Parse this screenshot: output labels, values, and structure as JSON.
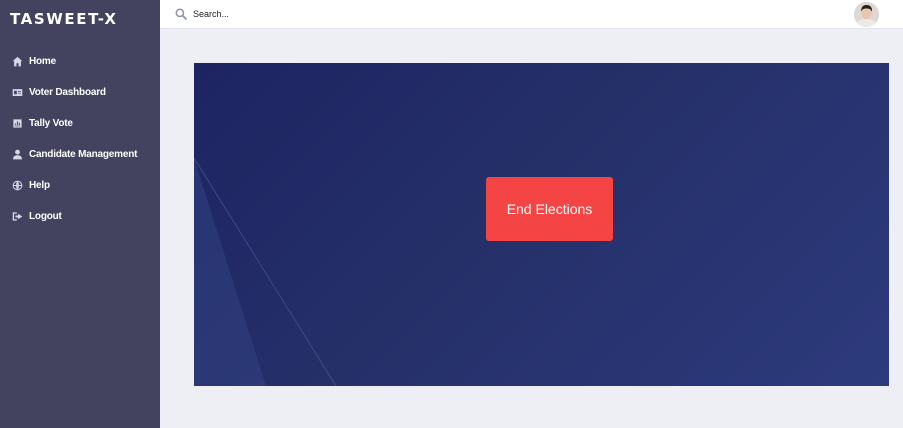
{
  "app": {
    "brand": "TASWEET-X"
  },
  "sidebar": {
    "items": [
      {
        "label": "Home",
        "icon": "home-icon"
      },
      {
        "label": "Voter Dashboard",
        "icon": "id-card-icon"
      },
      {
        "label": "Tally Vote",
        "icon": "chart-icon"
      },
      {
        "label": "Candidate Management",
        "icon": "user-icon"
      },
      {
        "label": "Help",
        "icon": "globe-icon"
      },
      {
        "label": "Logout",
        "icon": "sign-out-icon"
      }
    ]
  },
  "topbar": {
    "search": {
      "placeholder": "Search..."
    },
    "avatar_icon": "user-avatar"
  },
  "main": {
    "end_button_label": "End Elections"
  },
  "colors": {
    "sidebar": "#43435f",
    "hero": "#253069",
    "accent": "#f54444",
    "background": "#eeeff5"
  }
}
